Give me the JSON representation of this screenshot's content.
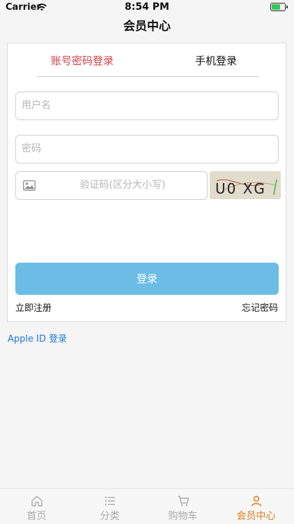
{
  "status_bar": {
    "carrier": "Carrier",
    "time": "8:54 PM"
  },
  "nav": {
    "title": "会员中心"
  },
  "login_card": {
    "tabs": [
      {
        "label": "账号密码登录",
        "active": true
      },
      {
        "label": "手机登录",
        "active": false
      }
    ],
    "username_placeholder": "用户名",
    "password_placeholder": "密码",
    "captcha_placeholder": "验证码(区分大小写)",
    "captcha_text": "U0 XG",
    "login_button": "登录",
    "register_link": "立即注册",
    "forgot_link": "忘记密码"
  },
  "apple_login": "Apple ID 登录",
  "tabbar": {
    "items": [
      {
        "label": "首页",
        "icon": "home-icon",
        "active": false
      },
      {
        "label": "分类",
        "icon": "list-icon",
        "active": false
      },
      {
        "label": "购物车",
        "icon": "cart-icon",
        "active": false
      },
      {
        "label": "会员中心",
        "icon": "user-icon",
        "active": true
      }
    ]
  },
  "colors": {
    "accent_red": "#d04148",
    "button_blue": "#6bbde6",
    "link_blue": "#1f7ad6",
    "tab_active_orange": "#e07a1a"
  }
}
